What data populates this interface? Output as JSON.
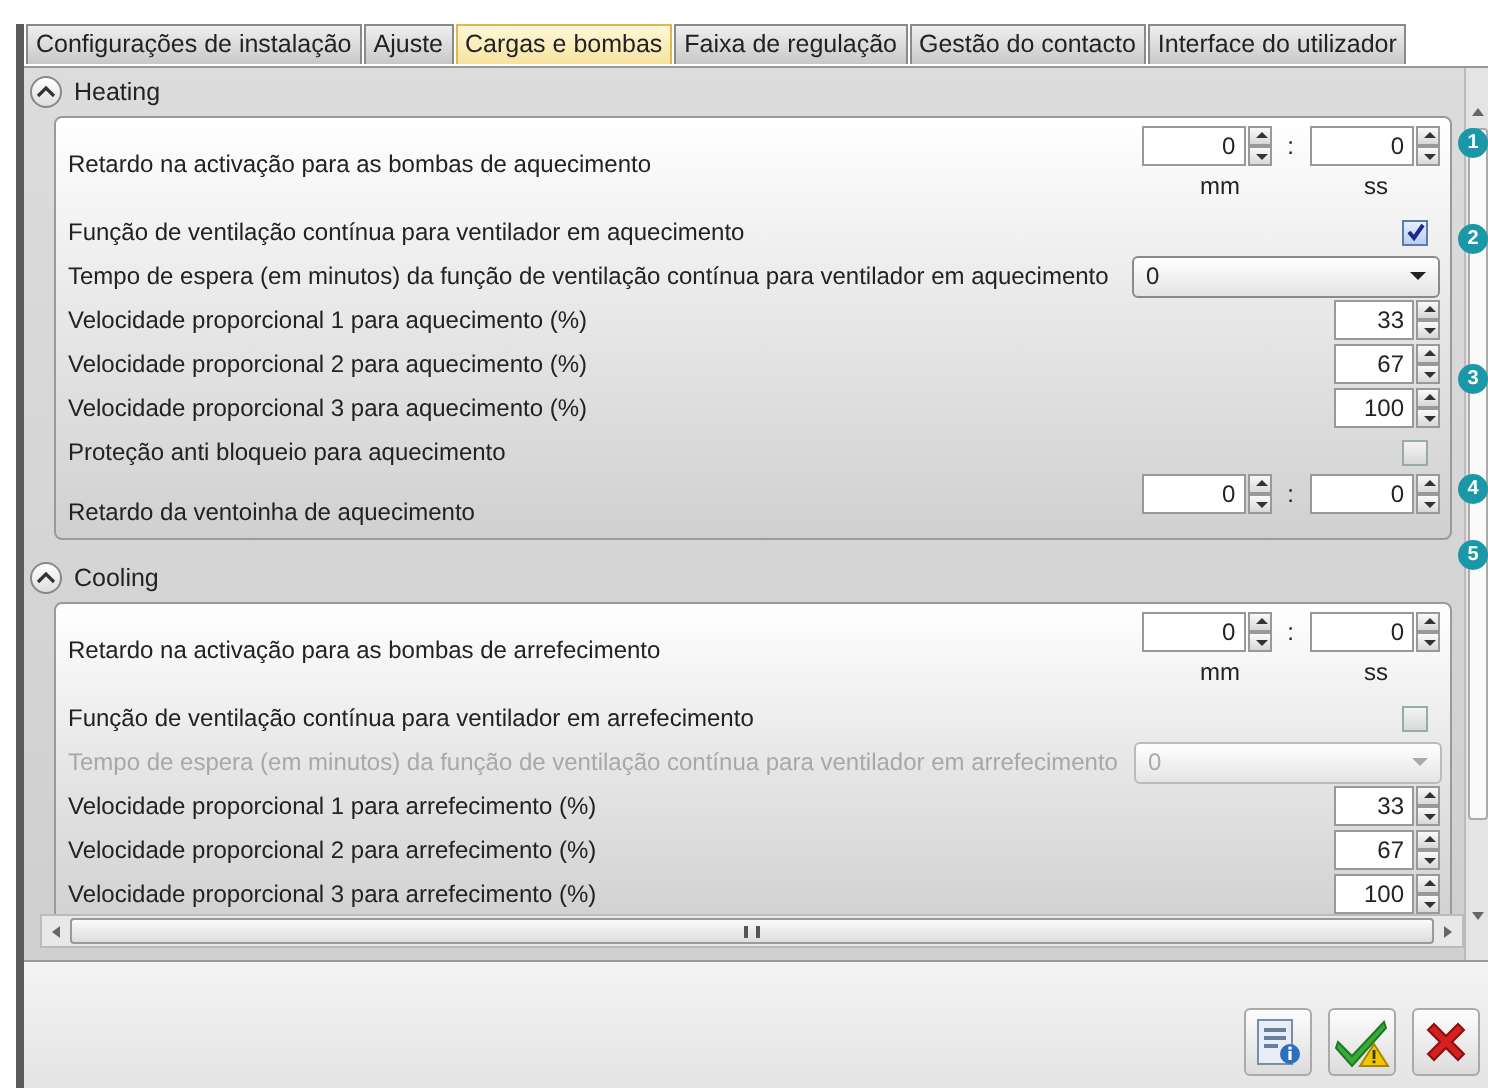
{
  "tabs": [
    {
      "label": "Configurações de instalação",
      "selected": false
    },
    {
      "label": "Ajuste",
      "selected": false
    },
    {
      "label": "Cargas e bombas",
      "selected": true
    },
    {
      "label": "Faixa de regulação",
      "selected": false
    },
    {
      "label": "Gestão do contacto",
      "selected": false
    },
    {
      "label": "Interface do utilizador",
      "selected": false
    }
  ],
  "sections": [
    {
      "title": "Heating",
      "expanded": true,
      "rows": [
        {
          "kind": "time",
          "label": "Retardo na activação para as bombas de aquecimento",
          "minutes": "0",
          "separator": ":",
          "seconds": "0",
          "minutes_unit": "mm",
          "seconds_unit": "ss"
        },
        {
          "kind": "checkbox",
          "label": "Função de ventilação contínua para ventilador em aquecimento",
          "checked": true
        },
        {
          "kind": "dropdown",
          "label": "Tempo de espera (em minutos) da função de ventilação contínua para ventilador em aquecimento",
          "value": "0",
          "disabled": false
        },
        {
          "kind": "spin",
          "label": "Velocidade proporcional 1 para aquecimento (%)",
          "value": "33"
        },
        {
          "kind": "spin",
          "label": "Velocidade proporcional 2 para aquecimento (%)",
          "value": "67"
        },
        {
          "kind": "spin",
          "label": "Velocidade proporcional 3 para aquecimento (%)",
          "value": "100"
        },
        {
          "kind": "checkbox",
          "label": "Proteção anti bloqueio para aquecimento",
          "checked": false
        },
        {
          "kind": "time",
          "label": "Retardo da ventoinha de aquecimento",
          "minutes": "0",
          "separator": ":",
          "seconds": "0"
        }
      ]
    },
    {
      "title": "Cooling",
      "expanded": true,
      "rows": [
        {
          "kind": "time",
          "label": "Retardo na activação para as bombas de arrefecimento",
          "minutes": "0",
          "separator": ":",
          "seconds": "0",
          "minutes_unit": "mm",
          "seconds_unit": "ss"
        },
        {
          "kind": "checkbox",
          "label": "Função de ventilação contínua para ventilador em arrefecimento",
          "checked": false
        },
        {
          "kind": "dropdown",
          "label": "Tempo de espera (em minutos) da função de ventilação contínua para ventilador em arrefecimento",
          "value": "0",
          "disabled": true
        },
        {
          "kind": "spin",
          "label": "Velocidade proporcional 1 para arrefecimento (%)",
          "value": "33"
        },
        {
          "kind": "spin",
          "label": "Velocidade proporcional 2 para arrefecimento (%)",
          "value": "67"
        },
        {
          "kind": "spin",
          "label": "Velocidade proporcional 3 para arrefecimento (%)",
          "value": "100"
        }
      ]
    }
  ],
  "callouts": [
    "1",
    "2",
    "3",
    "4",
    "5"
  ]
}
